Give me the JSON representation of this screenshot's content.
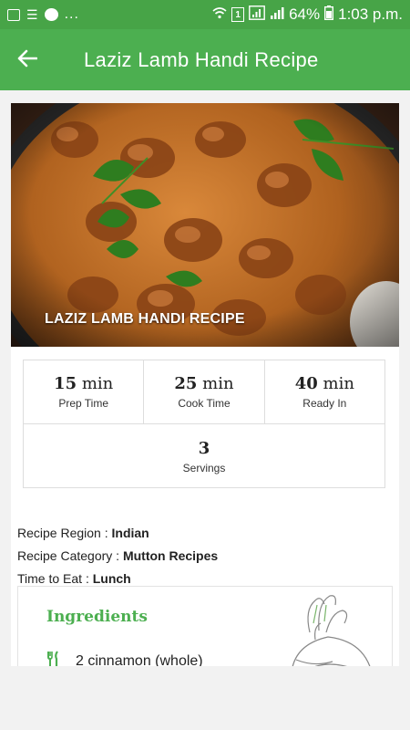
{
  "status_bar": {
    "more": "...",
    "battery": "64%",
    "time": "1:03 p.m."
  },
  "app_bar": {
    "title": "Laziz Lamb Handi Recipe"
  },
  "hero": {
    "caption": "LAZIZ LAMB HANDI RECIPE"
  },
  "stats": [
    {
      "value": "15",
      "unit": "min",
      "label": "Prep Time"
    },
    {
      "value": "25",
      "unit": "min",
      "label": "Cook Time"
    },
    {
      "value": "40",
      "unit": "min",
      "label": "Ready In"
    }
  ],
  "servings": {
    "value": "3",
    "label": "Servings"
  },
  "meta": {
    "region_label": "Recipe Region : ",
    "region_value": "Indian",
    "category_label": "Recipe Category : ",
    "category_value": "Mutton Recipes",
    "time_label": "Time to Eat : ",
    "time_value": "Lunch"
  },
  "ingredients": {
    "title": "Ingredients",
    "first_item": "2 cinnamon (whole)"
  },
  "colors": {
    "app_bar": "#4caf50",
    "status_bar": "#47a447",
    "accent": "#4caf50"
  }
}
